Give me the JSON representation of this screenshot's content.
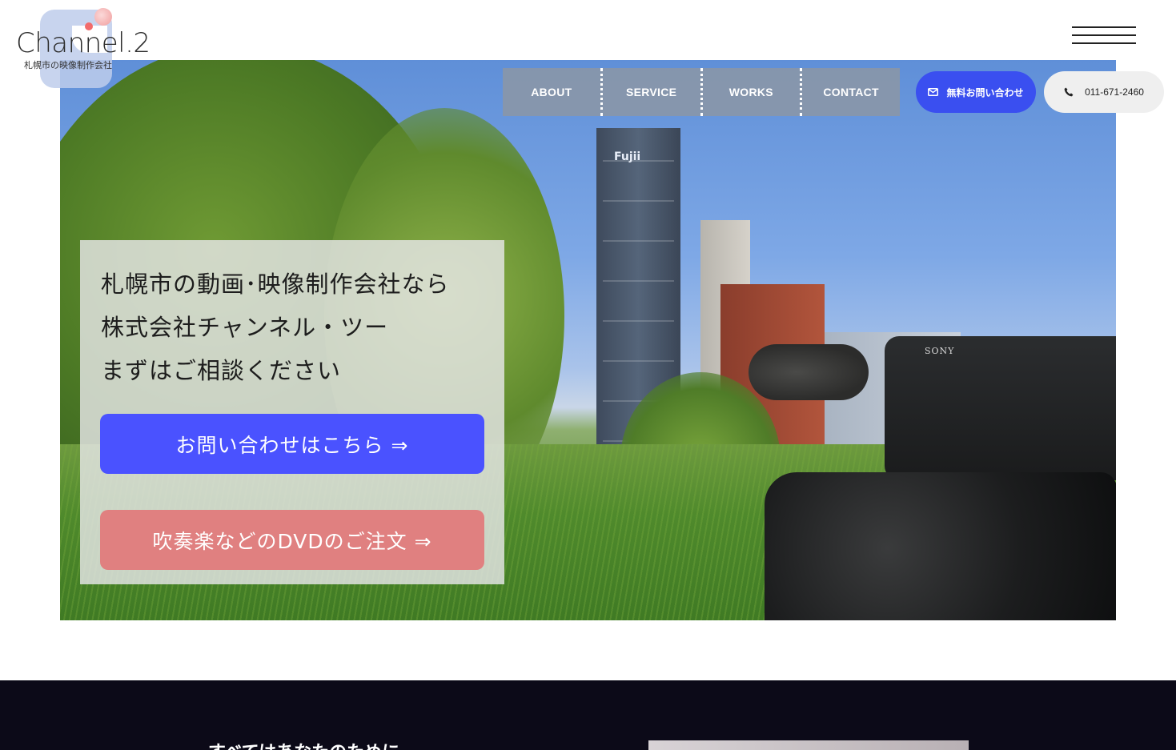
{
  "logo": {
    "name": "Channel.2",
    "subtitle": "札幌市の映像制作会社"
  },
  "nav": {
    "items": [
      "ABOUT",
      "SERVICE",
      "WORKS",
      "CONTACT"
    ]
  },
  "header_buttons": {
    "mail_label": "無料お問い合わせ",
    "mail_icon": "envelope-icon",
    "tel_label": "011-671-2460",
    "tel_icon": "phone-icon"
  },
  "hero": {
    "lines": [
      "札幌市の動画･映像制作会社なら",
      "株式会社チャンネル・ツー",
      "まずはご相談ください"
    ],
    "cta_contact": "お問い合わせはこちら ⇒",
    "cta_dvd": "吹奏楽などのDVDのご注文 ⇒",
    "photo_brand_text": "SONY",
    "building_sign": "Fujii"
  },
  "section2": {
    "heading": "すべてはあなたのために"
  },
  "colors": {
    "primary_blue": "#4a52ff",
    "mail_button": "#3a4ff0",
    "dvd_button": "#e08080",
    "dark_bg": "#0c0a18"
  }
}
